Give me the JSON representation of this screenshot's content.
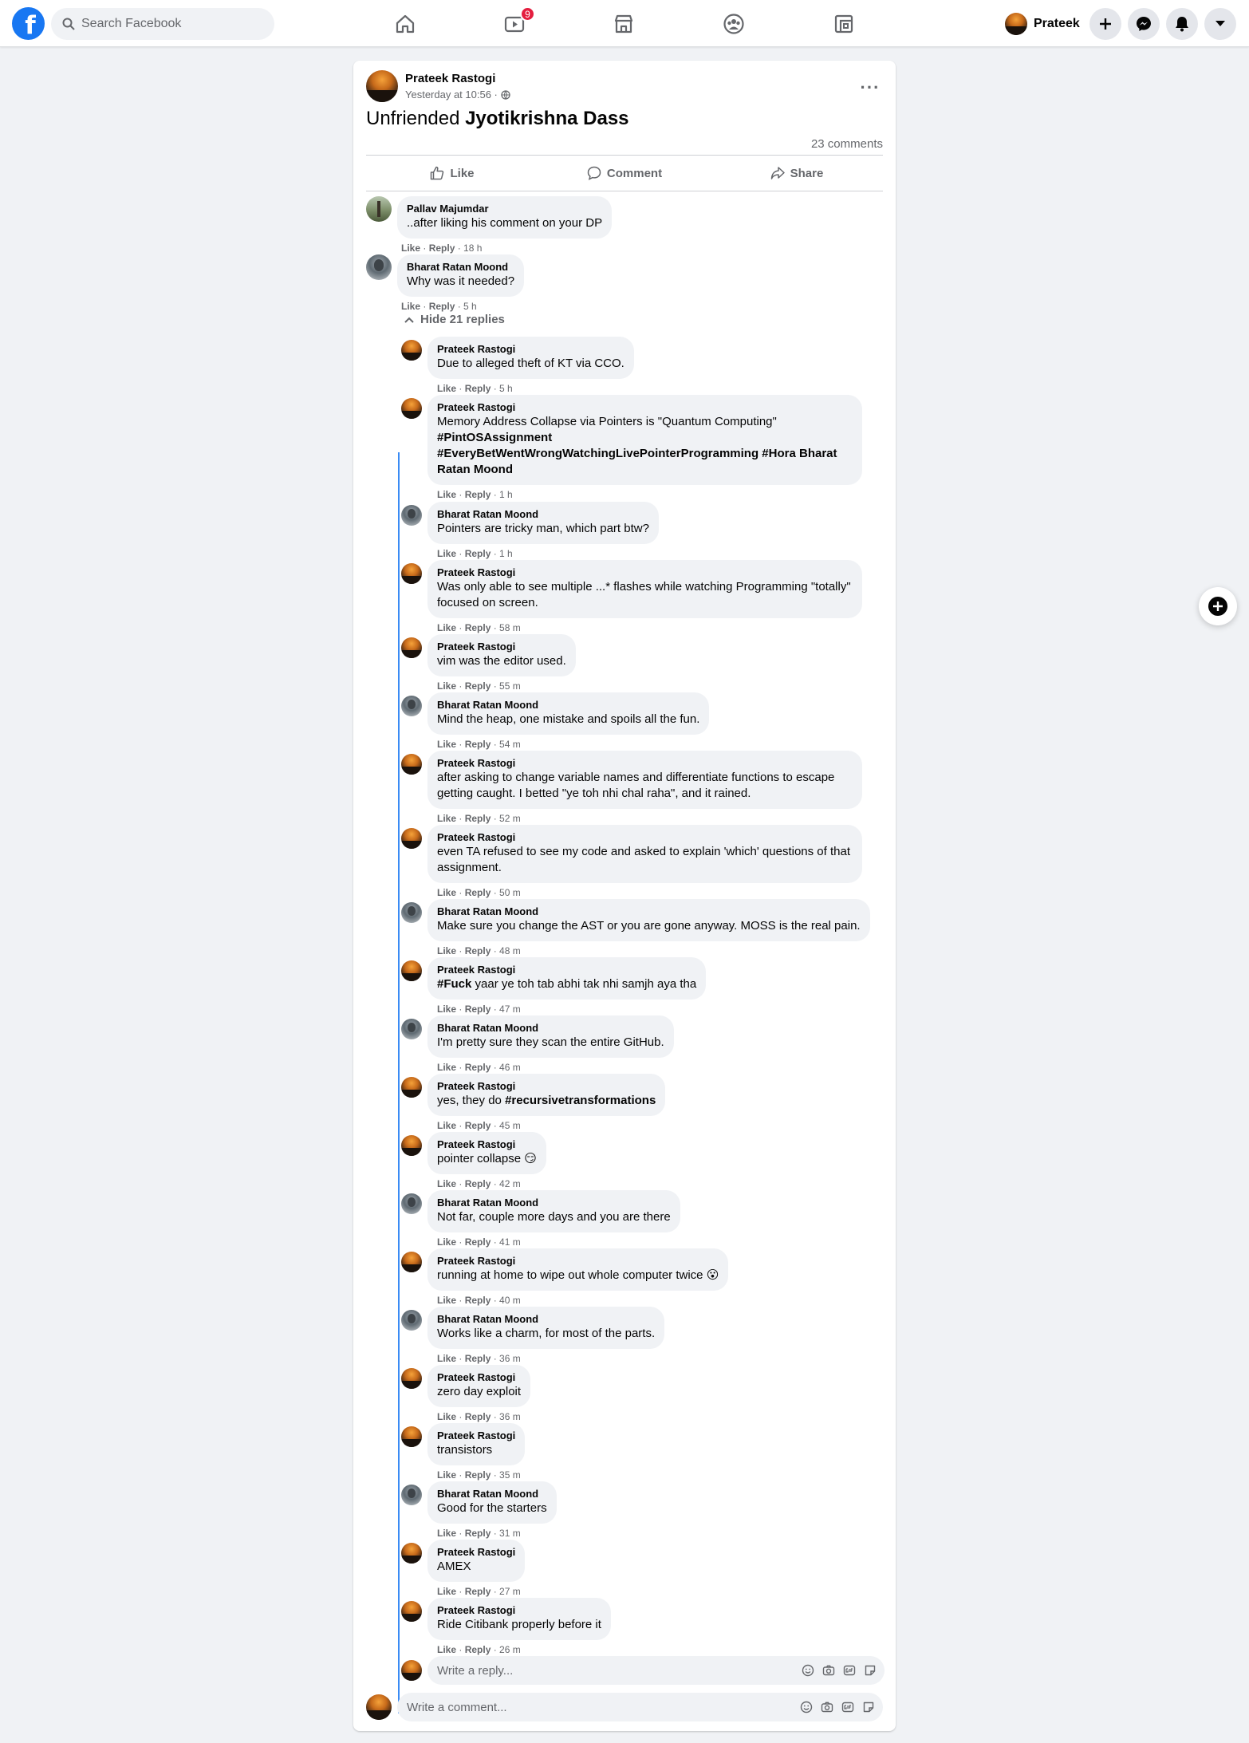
{
  "nav": {
    "logo_letter": "f",
    "search_placeholder": "Search Facebook",
    "watch_badge": "9",
    "profile_name": "Prateek",
    "tabs": [
      "home-icon",
      "watch-icon",
      "marketplace-icon",
      "groups-icon",
      "gaming-icon"
    ],
    "accent": "#1877f2"
  },
  "post": {
    "author": "Prateek Rastogi",
    "time": "Yesterday at 10:56 ·",
    "text_prefix": "Unfriended ",
    "text_name": "Jyotikrishna Dass",
    "comment_count": "23 comments",
    "actions": {
      "like": "Like",
      "comment": "Comment",
      "share": "Share"
    }
  },
  "comments": [
    {
      "name": "Pallav Majumdar",
      "text": "..after liking his comment on your DP",
      "time": "18 h"
    },
    {
      "name": "Bharat Ratan Moond",
      "text": "Why was it needed?",
      "time": "5 h"
    }
  ],
  "hide_replies": "Hide 21 replies",
  "replies": [
    {
      "name": "Prateek Rastogi",
      "text": "Due to alleged theft of KT via CCO.",
      "time": "5 h"
    },
    {
      "name": "Prateek Rastogi",
      "line1": "Memory Address Collapse via Pointers is \"Quantum Computing\"",
      "tag1": "#PintOSAssignment",
      "tag2": "#EveryBetWentWrongWatchingLivePointerProgramming",
      "tag3": "#Hora",
      "mention1": "Bharat",
      "mention2": "Ratan Moond",
      "time": "1 h"
    },
    {
      "name": "Bharat Ratan Moond",
      "text": "Pointers are tricky man, which part btw?",
      "time": "1 h"
    },
    {
      "name": "Prateek Rastogi",
      "line1": "Was only able to see multiple ...* flashes while watching Programming \"totally\"",
      "line2": "focused on screen.",
      "time": "58 m"
    },
    {
      "name": "Prateek Rastogi",
      "text": "vim was the editor used.",
      "time": "55 m"
    },
    {
      "name": "Bharat Ratan Moond",
      "text": "Mind the heap, one mistake and spoils all the fun.",
      "time": "54 m"
    },
    {
      "name": "Prateek Rastogi",
      "line1": "after asking to change variable names and differentiate functions to escape",
      "line2": "getting caught. I betted \"ye toh nhi chal raha\", and it rained.",
      "time": "52 m"
    },
    {
      "name": "Prateek Rastogi",
      "line1": "even TA refused to see my code and asked to explain 'which' questions of that",
      "line2": "assignment.",
      "time": "50 m"
    },
    {
      "name": "Bharat Ratan Moond",
      "text": "Make sure you change the AST or you are gone anyway. MOSS is the real pain.",
      "time": "48 m"
    },
    {
      "name": "Prateek Rastogi",
      "tag": "#Fuck",
      "text": " yaar ye toh tab abhi tak nhi samjh aya tha",
      "time": "47 m"
    },
    {
      "name": "Bharat Ratan Moond",
      "text": "I'm pretty sure they scan the entire GitHub.",
      "time": "46 m"
    },
    {
      "name": "Prateek Rastogi",
      "text": "yes, they do ",
      "tag": "#recursivetransformations",
      "time": "45 m"
    },
    {
      "name": "Prateek Rastogi",
      "text": "pointer collapse",
      "emoji": "😏",
      "time": "42 m"
    },
    {
      "name": "Bharat Ratan Moond",
      "text": "Not far, couple more days and you are there",
      "time": "41 m"
    },
    {
      "name": "Prateek Rastogi",
      "text": "running at home to wipe out whole computer twice",
      "emoji": "😮",
      "time": "40 m"
    },
    {
      "name": "Bharat Ratan Moond",
      "text": "Works like a charm, for most of the parts.",
      "time": "36 m"
    },
    {
      "name": "Prateek Rastogi",
      "text": "zero day exploit",
      "time": "36 m"
    },
    {
      "name": "Prateek Rastogi",
      "text": "transistors",
      "time": "35 m"
    },
    {
      "name": "Bharat Ratan Moond",
      "text": "Good for the starters",
      "time": "31 m"
    },
    {
      "name": "Prateek Rastogi",
      "text": "AMEX",
      "time": "27 m"
    },
    {
      "name": "Prateek Rastogi",
      "text": "Ride Citibank properly before it",
      "time": "26 m"
    }
  ],
  "ui": {
    "like": "Like",
    "reply": "Reply",
    "sep": " · "
  },
  "reply_placeholder": "Write a reply...",
  "comment_placeholder": "Write a comment..."
}
